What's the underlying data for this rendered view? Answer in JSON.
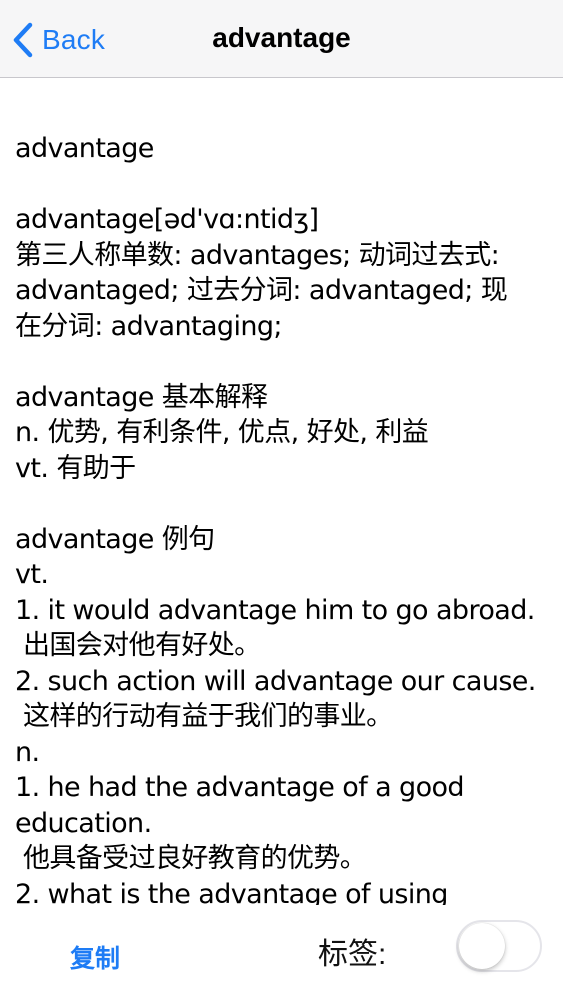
{
  "navbar": {
    "back_label": "Back",
    "title": "advantage"
  },
  "content": {
    "text": "advantage\n\nadvantage[əd'vɑ:ntidʒ]\n第三人称单数: advantages; 动词过去式:\nadvantaged; 过去分词: advantaged; 现\n在分词: advantaging;\n\nadvantage 基本解释\nn. 优势, 有利条件, 优点, 好处, 利益\nvt. 有助于\n\nadvantage 例句\nvt.\n1. it would advantage him to go abroad.\n 出国会对他有好处。\n2. such action will advantage our cause.\n 这样的行动有益于我们的事业。\nn.\n1. he had the advantage of a good\neducation.\n 他具备受过良好教育的优势。\n2. what is the advantage of using"
  },
  "bottombar": {
    "copy_label": "复制",
    "tag_label": "标签:",
    "tag_toggle_on": false
  },
  "colors": {
    "accent": "#1e7cf5",
    "navbar_bg": "#f6f6f7",
    "toggle_border": "#e5e5ea"
  }
}
